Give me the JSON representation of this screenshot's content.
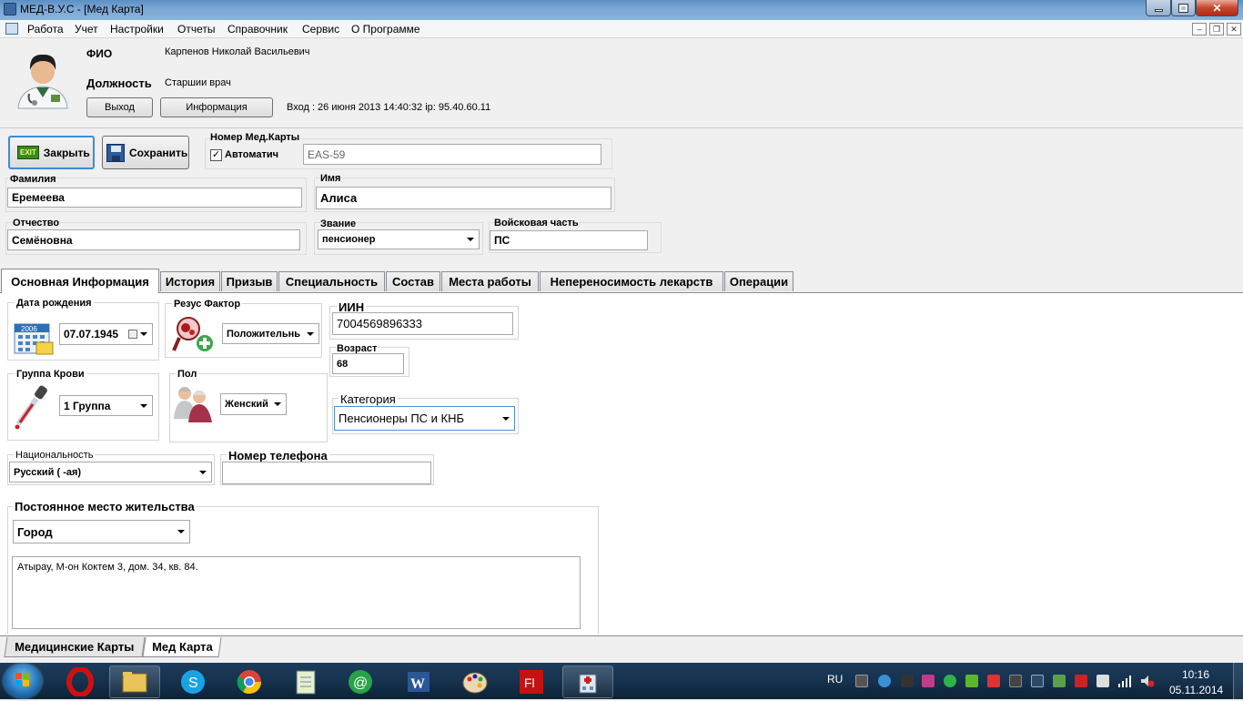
{
  "window": {
    "title": "МЕД-В.У.С - [Мед Карта]"
  },
  "menu": [
    "Работа",
    "Учет",
    "Настройки",
    "Отчеты",
    "Справочник",
    "Сервис",
    "О Программе"
  ],
  "header": {
    "fio_label": "ФИО",
    "fio_value": "Карпенов Николай Васильевич",
    "position_label": "Должность",
    "position_value": "Старшии врач",
    "exit_button": "Выход",
    "info_button": "Информация",
    "login_info": "Вход : 26 июня 2013 14:40:32 ip: 95.40.60.11"
  },
  "toolbar": {
    "close_icon_text": "EXIT",
    "close_button": "Закрыть",
    "save_button": "Сохранить",
    "card_number_label": "Номер Мед.Карты",
    "auto_label": "Автоматич",
    "auto_checked": true,
    "card_number_value": "EAS-59"
  },
  "person": {
    "surname_label": "Фамилия",
    "surname_value": "Еремеева",
    "name_label": "Имя",
    "name_value": "Алиса",
    "patronymic_label": "Отчество",
    "patronymic_value": "Семёновна",
    "rank_label": "Звание",
    "rank_value": "пенсионер",
    "unit_label": "Войсковая часть",
    "unit_value": "ПС"
  },
  "tabs": [
    "Основная Информация",
    "История",
    "Призыв",
    "Специальность",
    "Состав",
    "Места работы",
    "Непереносимость лекарств",
    "Операции"
  ],
  "main": {
    "birthdate_label": "Дата рождения",
    "birthdate_value": "07.07.1945",
    "calendar_year": "2006",
    "rh_label": "Резус Фактор",
    "rh_value": "Положительнь",
    "iin_label": "ИИН",
    "iin_value": "7004569896333",
    "age_label": "Возраст",
    "age_value": "68",
    "blood_label": "Группа Крови",
    "blood_value": "1 Группа",
    "sex_label": "Пол",
    "sex_value": "Женский",
    "category_label": "Категория",
    "category_value": "Пенсионеры ПС и КНБ",
    "nationality_label": "Национальность",
    "nationality_value": "Русский ( -ая)",
    "phone_label": "Номер телефона",
    "phone_value": "",
    "residence_label": "Постоянное место жительства",
    "residence_type": "Город",
    "address": "Атырау, М-он Коктем 3, дом. 34, кв. 84."
  },
  "bottom_tabs": [
    "Медицинские Карты",
    "Мед Карта"
  ],
  "taskbar": {
    "lang": "RU",
    "time": "10:16",
    "date": "05.11.2014",
    "apps": [
      "explorer",
      "opera",
      "skype",
      "chrome",
      "notepad",
      "mail-agent",
      "word",
      "paint",
      "flash",
      "medvus"
    ]
  },
  "colors": {
    "titlebar": "#6f9dcf",
    "taskbar": "#16324e",
    "tab_active": "#ffffff"
  }
}
